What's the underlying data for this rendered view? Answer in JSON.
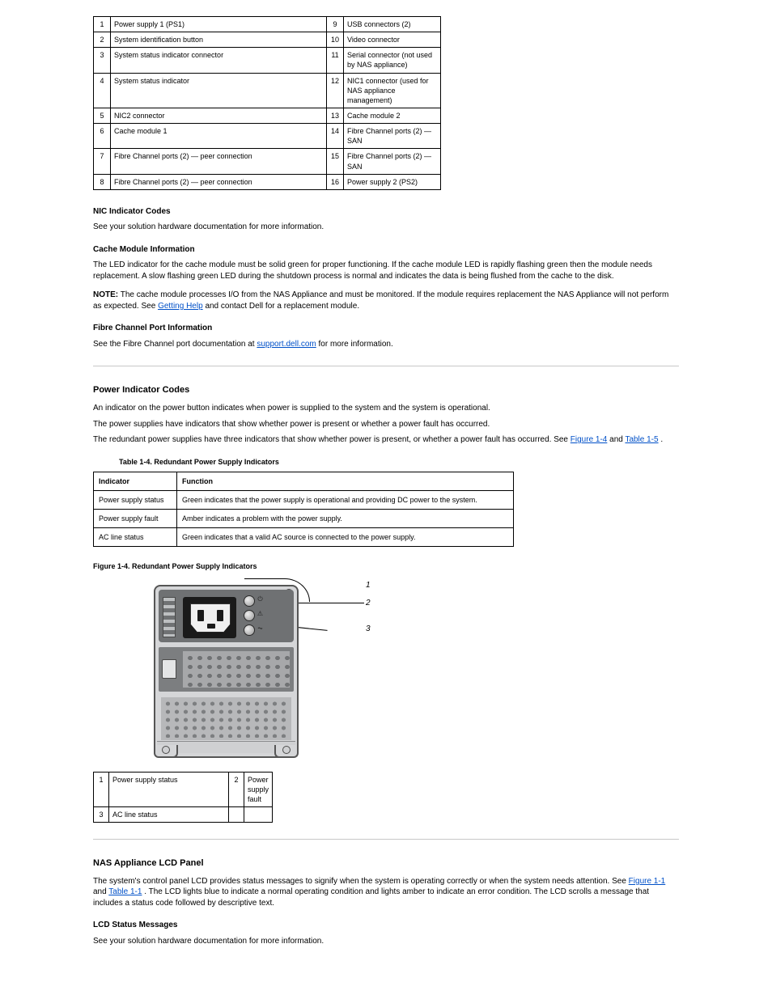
{
  "table3": {
    "rows": [
      {
        "n1": "1",
        "l1": "Power supply 1 (PS1)",
        "n2": "9",
        "l2": "USB connectors (2)"
      },
      {
        "n1": "2",
        "l1": "System identification button",
        "n2": "10",
        "l2": "Video connector"
      },
      {
        "n1": "3",
        "l1": "System status indicator connector",
        "n2": "11",
        "l2": "Serial connector (not used by NAS appliance)"
      },
      {
        "n1": "4",
        "l1": "System status indicator",
        "n2": "12",
        "l2": "NIC1 connector (used for NAS appliance management)"
      },
      {
        "n1": "5",
        "l1": "NIC2 connector",
        "n2": "13",
        "l2": "Cache module 2"
      },
      {
        "n1": "6",
        "l1": "Cache module 1",
        "n2": "14",
        "l2": "Fibre Channel ports (2) — SAN"
      },
      {
        "n1": "7",
        "l1": "Fibre Channel ports (2) — peer connection",
        "n2": "15",
        "l2": "Fibre Channel ports (2) — SAN"
      },
      {
        "n1": "8",
        "l1": "Fibre Channel ports (2) — peer connection",
        "n2": "16",
        "l2": "Power supply 2 (PS2)"
      }
    ]
  },
  "sec_nic": {
    "title": "NIC Indicator Codes",
    "body": "See your solution hardware documentation for more information."
  },
  "sec_cache": {
    "title": "Cache Module Information",
    "body": "The LED indicator for the cache module must be solid green for proper functioning. If the cache module LED is rapidly flashing green then the module needs replacement. A slow flashing green LED during the shutdown process is normal and indicates the data is being flushed from the cache to the disk."
  },
  "note": {
    "label": "NOTE:",
    "body": "The cache module processes I/O from the NAS Appliance and must be monitored. If the module requires replacement the NAS Appliance will not perform as expected. See ",
    "link1": "Getting Help",
    "mid": " and contact Dell for a replacement module."
  },
  "sec_fc": {
    "title": "Fibre Channel Port Information",
    "link_text": "support.dell.com",
    "tail": " for more information.",
    "body_pre": "See the Fibre Channel port documentation at "
  },
  "hr": "",
  "sec_power": {
    "title": "Power Indicator Codes",
    "p1_a": "An indicator on the power button indicates when power is supplied to the system and the system is operational.",
    "p1_b": "The power supplies have indicators that show whether power is present or whether a power fault has occurred.",
    "p2_a": "The redundant power supplies have three indicators that show whether power is present, or whether a power fault has occurred. See ",
    "fig_link": "Figure 1-4",
    "and": " and ",
    "tbl_link": "Table 1-5",
    "p2_c": "."
  },
  "tbl4": {
    "caption": "Table 1-4. Redundant Power Supply Indicators",
    "head": {
      "c1": "Indicator",
      "c2": "Function"
    },
    "rows": [
      {
        "c1": "Power supply status",
        "c2": "Green indicates that the power supply is operational and providing DC power to the system."
      },
      {
        "c1": "Power supply fault",
        "c2": "Amber indicates a problem with the power supply."
      },
      {
        "c1": "AC line status",
        "c2": "Green indicates that a valid AC source is connected to the power supply."
      }
    ]
  },
  "fig4": {
    "caption": "Figure 1-4.  Redundant Power Supply Indicators"
  },
  "key": {
    "rows": [
      {
        "n": "1",
        "l": "Power supply status",
        "n2": "2",
        "l2": "Power supply fault"
      },
      {
        "n": "3",
        "l": "AC line status",
        "n2": "",
        "l2": ""
      }
    ]
  },
  "sec_lcd": {
    "title": "NAS Appliance LCD Panel",
    "p_a": "The system's control panel LCD provides status messages to signify when the system is operating correctly or when the system needs attention. See ",
    "fig_link": "Figure 1-1",
    "and": " and ",
    "tbl_link": "Table 1-1",
    "p_b": ". The LCD lights blue to indicate a normal operating condition and lights amber to indicate an error condition. The LCD scrolls a message that includes a status code followed by descriptive text.",
    "sub_title": "LCD Status Messages",
    "sub_body": "See your solution hardware documentation for more information."
  },
  "chart_data": null
}
